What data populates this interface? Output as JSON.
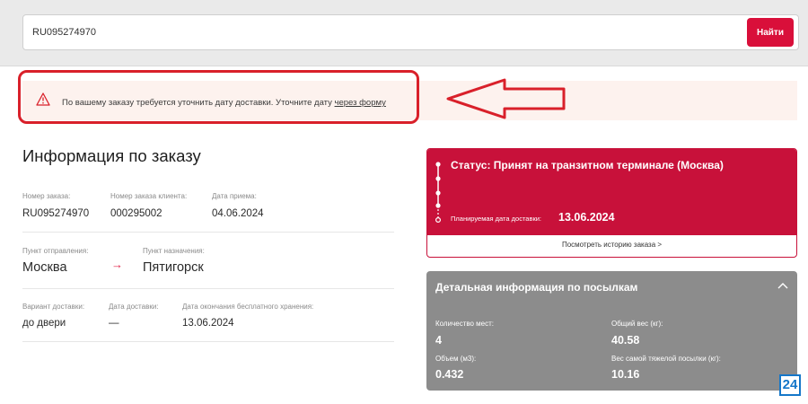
{
  "search": {
    "value": "RU095274970",
    "button_label": "Найти"
  },
  "alert": {
    "text": "По вашему заказу требуется уточнить дату доставки. Уточните дату ",
    "link_text": "через форму"
  },
  "order_info": {
    "title": "Информация по заказу",
    "order_number_label": "Номер заказа:",
    "order_number": "RU095274970",
    "client_order_label": "Номер заказа клиента:",
    "client_order": "000295002",
    "accept_date_label": "Дата приема:",
    "accept_date": "04.06.2024",
    "from_label": "Пункт отправления:",
    "from": "Москва",
    "route_arrow": "→",
    "to_label": "Пункт назначения:",
    "to": "Пятигорск",
    "delivery_type_label": "Вариант доставки:",
    "delivery_type": "до двери",
    "delivery_date_label": "Дата доставки:",
    "delivery_date": "—",
    "storage_end_label": "Дата окончания бесплатного хранения:",
    "storage_end": "13.06.2024"
  },
  "status_card": {
    "title": "Статус: Принят на транзитном терминале (Москва)",
    "planned_label": "Планируемая дата доставки:",
    "planned_date": "13.06.2024",
    "history_link": "Посмотреть историю заказа >",
    "accent_color": "#c8113a"
  },
  "parcel_card": {
    "title": "Детальная информация по посылкам",
    "places_label": "Количество мест:",
    "places": "4",
    "weight_label": "Общий вес (кг):",
    "weight": "40.58",
    "volume_label": "Объем (м3):",
    "volume": "0.432",
    "heaviest_label": "Вес самой тяжелой посылки (кг):",
    "heaviest": "10.16"
  },
  "badge": {
    "text": "24"
  },
  "icons": {
    "alert": "warning-triangle-icon",
    "annotation": "arrow-left-icon",
    "collapse": "chevron-up-icon"
  }
}
